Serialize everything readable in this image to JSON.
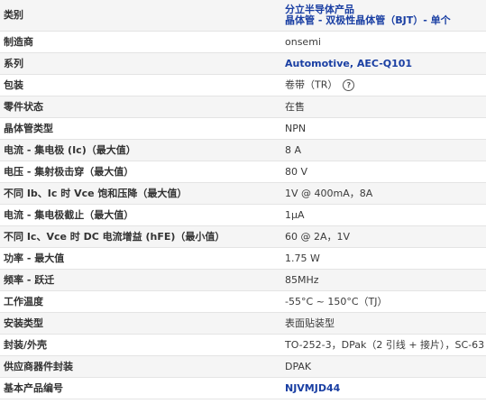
{
  "rows": [
    {
      "label": "类别",
      "value_lines": [
        "分立半导体产品",
        "晶体管 - 双极性晶体管（BJT）- 单个"
      ]
    },
    {
      "label": "制造商",
      "value": "onsemi"
    },
    {
      "label": "系列",
      "value": "Automotive, AEC-Q101"
    },
    {
      "label": "包装",
      "value": "卷带（TR）",
      "help_icon": "?"
    },
    {
      "label": "零件状态",
      "value": "在售"
    },
    {
      "label": "晶体管类型",
      "value": "NPN"
    },
    {
      "label": "电流 - 集电极 (Ic)（最大值）",
      "value": "8 A"
    },
    {
      "label": "电压 - 集射极击穿（最大值）",
      "value": "80 V"
    },
    {
      "label": "不同 Ib、Ic 时 Vce 饱和压降（最大值）",
      "value": "1V @ 400mA，8A"
    },
    {
      "label": "电流 - 集电极截止（最大值）",
      "value": "1μA"
    },
    {
      "label": "不同 Ic、Vce 时 DC 电流增益 (hFE)（最小值）",
      "value": "60 @ 2A，1V"
    },
    {
      "label": "功率 - 最大值",
      "value": "1.75 W"
    },
    {
      "label": "频率 - 跃迁",
      "value": "85MHz"
    },
    {
      "label": "工作温度",
      "value": "-55°C ~ 150°C（TJ）"
    },
    {
      "label": "安装类型",
      "value": "表面贴装型"
    },
    {
      "label": "封装/外壳",
      "value": "TO-252-3，DPak（2 引线 + 接片），SC-63"
    },
    {
      "label": "供应商器件封装",
      "value": "DPAK"
    },
    {
      "label": "基本产品编号",
      "value": "NJVMJD44"
    }
  ],
  "colors": {
    "link": "#1a3fa3",
    "stripe": "#f5f5f5",
    "border": "#e4e4e4"
  }
}
